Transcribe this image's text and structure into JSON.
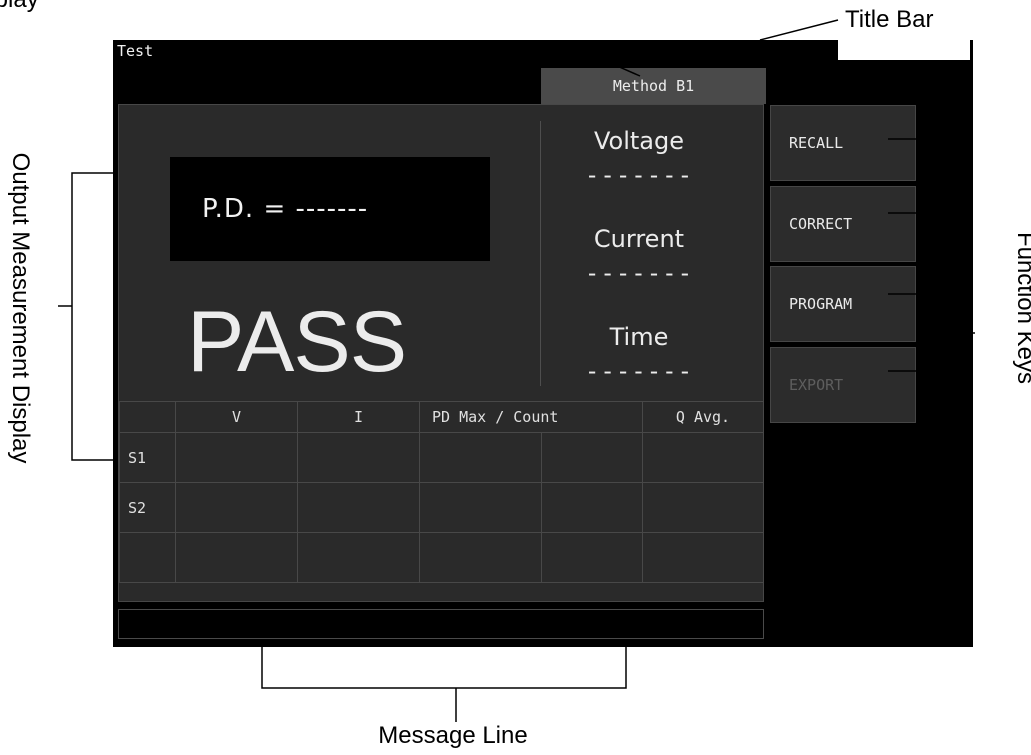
{
  "callouts": {
    "title_bar": "Title Bar",
    "function_keys": "Function Keys",
    "output_display": "Output Measurement Display",
    "message_line": "Message Line",
    "top_left_fragment": "Display"
  },
  "screen": {
    "title": "Test",
    "method_tab": "Method B1",
    "pd_readout": "P.D. = -------",
    "result": "PASS",
    "measurements": [
      {
        "label": "Voltage",
        "value": "-------"
      },
      {
        "label": "Current",
        "value": "-------"
      },
      {
        "label": "Time",
        "value": "-------"
      }
    ],
    "table": {
      "headers": [
        "",
        "V",
        "I",
        "PD Max / Count",
        "Q Avg."
      ],
      "rows": [
        {
          "label": "S1",
          "cells": [
            "",
            "",
            "",
            "",
            ""
          ]
        },
        {
          "label": "S2",
          "cells": [
            "",
            "",
            "",
            "",
            ""
          ]
        },
        {
          "label": "",
          "cells": [
            "",
            "",
            "",
            "",
            ""
          ]
        }
      ]
    },
    "message": "",
    "function_keys": [
      {
        "label": "RECALL",
        "enabled": true
      },
      {
        "label": "CORRECT",
        "enabled": true
      },
      {
        "label": "PROGRAM",
        "enabled": true
      },
      {
        "label": "EXPORT",
        "enabled": false
      }
    ]
  }
}
